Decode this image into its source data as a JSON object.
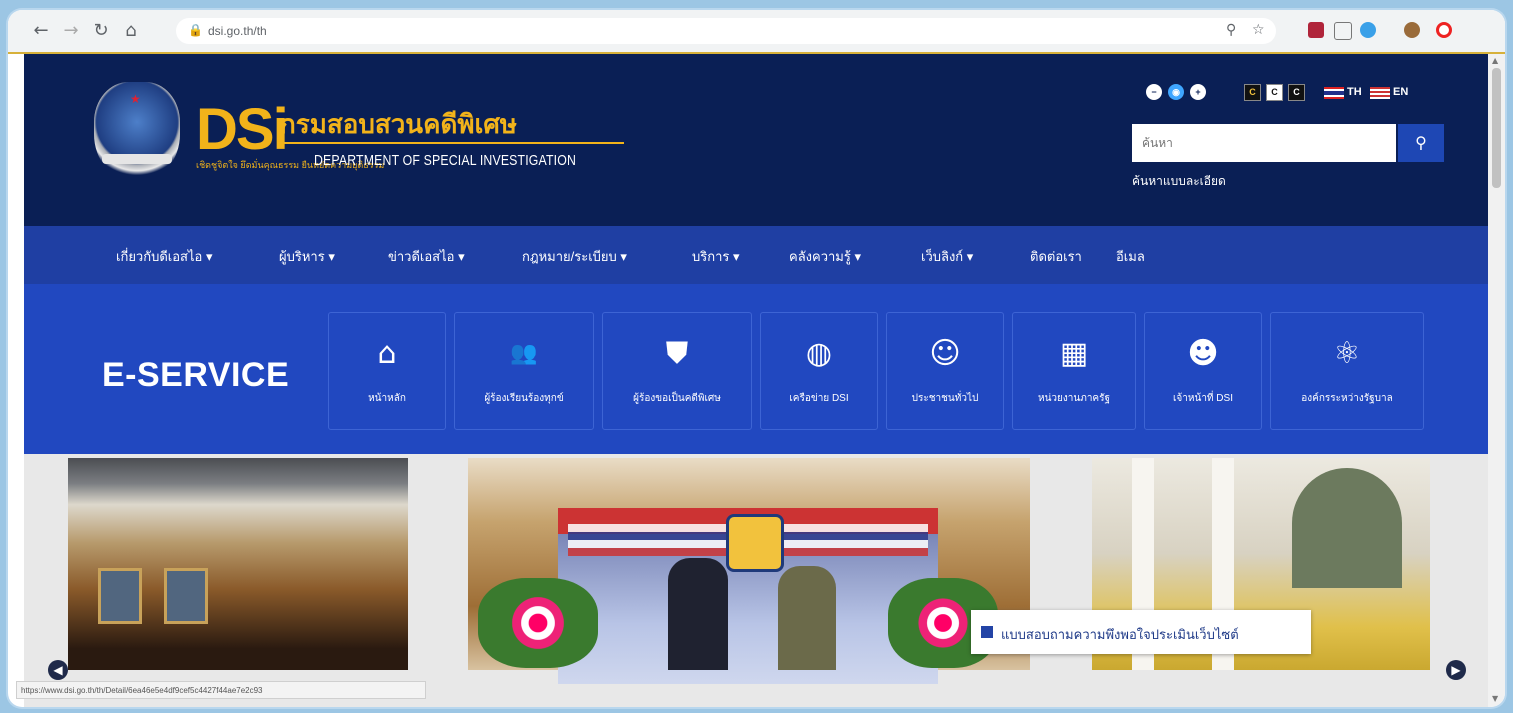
{
  "browser": {
    "url": "dsi.go.th/th",
    "status_url": "https://www.dsi.go.th/th/Detail/6ea46e5e4df9cef5c4427f44ae7e2c93"
  },
  "header": {
    "logo_abbr": "DSi",
    "org_name_th": "กรมสอบสวนคดีพิเศษ",
    "org_tagline_th": "เชิดชูจิตใจ ยึดมั่นคุณธรรม ยืนหยัดความยุติธรรม",
    "org_name_en": "DEPARTMENT OF SPECIAL INVESTIGATION",
    "lang_th": "TH",
    "lang_en": "EN",
    "search_placeholder": "ค้นหา",
    "advanced_search": "ค้นหาแบบละเอียด"
  },
  "nav": [
    {
      "label": "เกี่ยวกับดีเอสไอ ▾"
    },
    {
      "label": "ผู้บริหาร ▾"
    },
    {
      "label": "ข่าวดีเอสไอ ▾"
    },
    {
      "label": "กฎหมาย/ระเบียบ ▾"
    },
    {
      "label": "บริการ ▾"
    },
    {
      "label": "คลังความรู้ ▾"
    },
    {
      "label": "เว็บลิงก์ ▾"
    },
    {
      "label": "ติดต่อเรา"
    },
    {
      "label": "อีเมล"
    }
  ],
  "eservice": {
    "title": "E-SERVICE",
    "cards": [
      {
        "label": "หน้าหลัก",
        "icon": "home-icon"
      },
      {
        "label": "ผู้ร้องเรียนร้องทุกข์",
        "icon": "people-icon"
      },
      {
        "label": "ผู้ร้องขอเป็นคดีพิเศษ",
        "icon": "badge-icon"
      },
      {
        "label": "เครือข่าย DSI",
        "icon": "globe-icon"
      },
      {
        "label": "ประชาชนทั่วไป",
        "icon": "person-icon"
      },
      {
        "label": "หน่วยงานภาครัฐ",
        "icon": "building-icon"
      },
      {
        "label": "เจ้าหน้าที่ DSI",
        "icon": "officer-icon"
      },
      {
        "label": "องค์กรระหว่างรัฐบาล",
        "icon": "atom-icon"
      }
    ]
  },
  "survey": {
    "label": "แบบสอบถามความพึงพอใจประเมินเว็บไซต์"
  },
  "colors": {
    "header_bg": "#0a1f55",
    "nav_bg": "#1f3fa3",
    "eservice_bg": "#2148c0",
    "logo_gold": "#f2b31a"
  }
}
